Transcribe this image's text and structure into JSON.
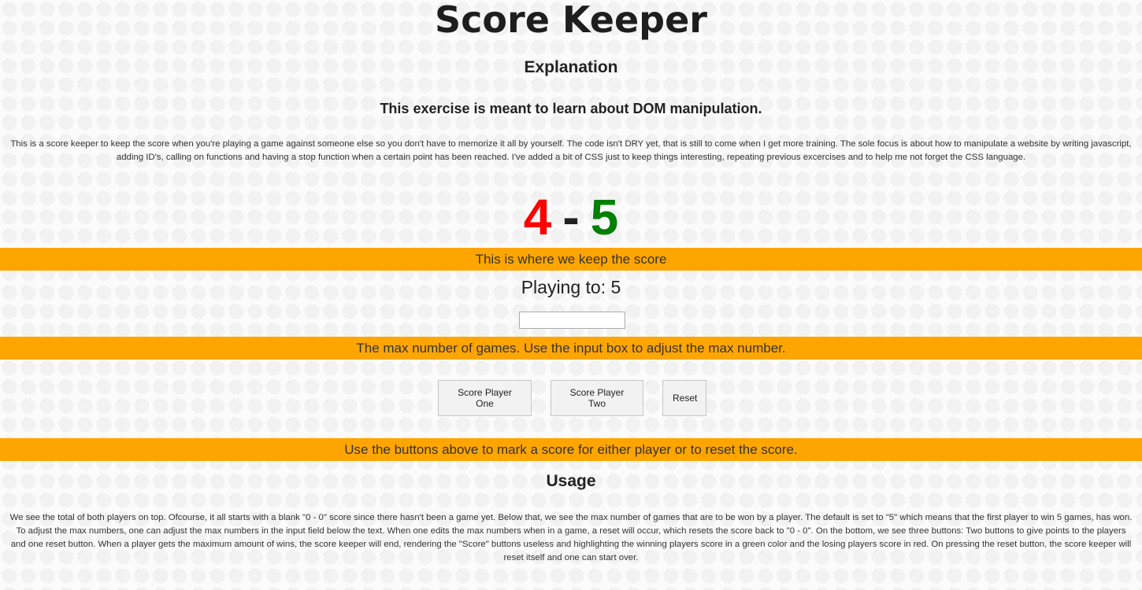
{
  "title": "Score Keeper",
  "explanation": {
    "heading": "Explanation",
    "subheading": "This exercise is meant to learn about DOM manipulation.",
    "text": "This is a score keeper to keep the score when you're playing a game against someone else so you don't have to memorize it all by yourself. The code isn't DRY yet, that is still to come when I get more training. The sole focus is about how to manipulate a website by writing javascript, adding ID's, calling on functions and having a stop function when a certain point has been reached. I've added a bit of CSS just to keep things interesting, repeating previous excercises and to help me not forget the CSS language."
  },
  "score": {
    "player_one": "4",
    "separator": "-",
    "player_two": "5",
    "colors": {
      "player_one": "#ff0000",
      "player_two": "#008000"
    }
  },
  "banners": {
    "score": "This is where we keep the score",
    "max": "The max number of games. Use the input box to adjust the max number.",
    "buttons": "Use the buttons above to mark a score for either player or to reset the score.",
    "color": "#ffa500"
  },
  "playing_to": {
    "label": "Playing to: 5",
    "input_value": ""
  },
  "buttons": {
    "player_one": "Score Player One",
    "player_two": "Score Player Two",
    "reset": "Reset"
  },
  "usage": {
    "heading": "Usage",
    "text": "We see the total of both players on top. Ofcourse, it all starts with a blank \"0 - 0\" score since there hasn't been a game yet. Below that, we see the max number of games that are to be won by a player. The default is set to \"5\" which means that the first player to win 5 games, has won. To adjust the max numbers, one can adjust the max numbers in the input field below the text. When one edits the max numbers when in a game, a reset will occur, which resets the score back to \"0 - 0\". On the bottom, we see three buttons: Two buttons to give points to the players and one reset button. When a player gets the maximum amount of wins, the score keeper will end, rendering the \"Score\" buttons useless and highlighting the winning players score in a green color and the losing players score in red. On pressing the reset button, the score keeper will reset itself and one can start over."
  }
}
